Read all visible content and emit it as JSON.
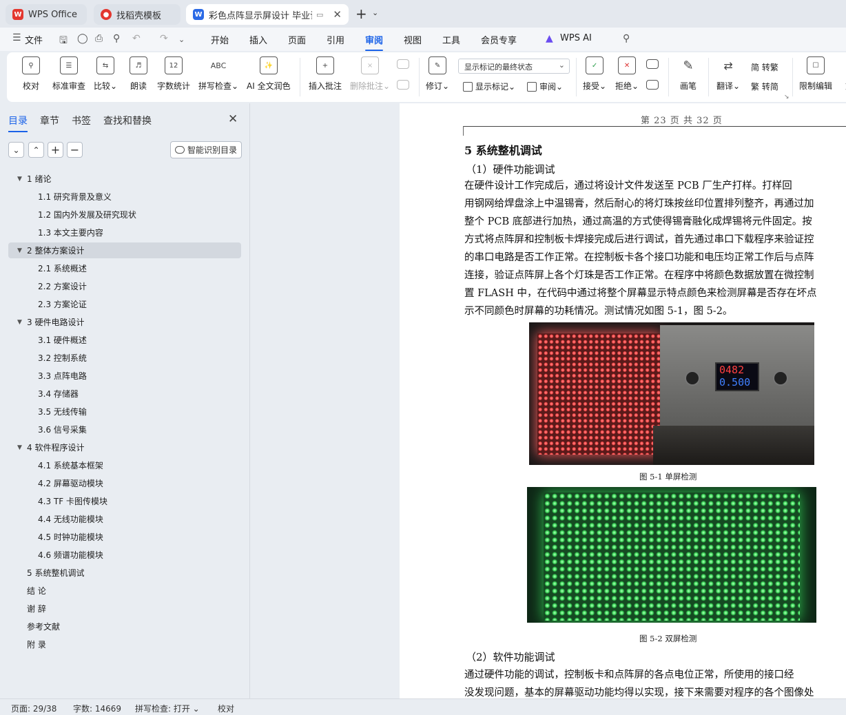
{
  "tabs": [
    {
      "label": "WPS Office",
      "icon": "wps-logo-icon"
    },
    {
      "label": "找稻壳模板",
      "icon": "docer-logo-icon"
    },
    {
      "label": "彩色点阵显示屏设计 毕业论文",
      "icon": "word-doc-icon"
    }
  ],
  "menu": {
    "file": "文件",
    "items": [
      "开始",
      "插入",
      "页面",
      "引用",
      "审阅",
      "视图",
      "工具",
      "会员专享"
    ],
    "active": "审阅",
    "ai": "WPS AI"
  },
  "ribbon": {
    "proofread": "校对",
    "std_review": "标准审查",
    "compare": "比较",
    "read_aloud": "朗读",
    "word_count": "字数统计",
    "spell_check": "拼写检查",
    "ai_polish": "AI 全文润色",
    "insert_comment": "插入批注",
    "delete_comment": "删除批注",
    "track": "修订",
    "markup_mode": "显示标记的最终状态",
    "show_markup": "显示标记",
    "review_pane": "审阅",
    "accept": "接受",
    "reject": "拒绝",
    "pen": "画笔",
    "translate": "翻译",
    "to_traditional": "简 转繁",
    "to_simplified": "繁 转简",
    "restrict": "限制编辑",
    "doc_partial": "文"
  },
  "nav": {
    "tabs": [
      "目录",
      "章节",
      "书签",
      "查找和替换"
    ],
    "smart_toc": "智能识别目录",
    "toc": [
      {
        "label": "1   绪论",
        "level": 1,
        "expand": true
      },
      {
        "label": "1.1  研究背景及意义",
        "level": 2
      },
      {
        "label": "1.2  国内外发展及研究现状",
        "level": 2
      },
      {
        "label": "1.3  本文主要内容",
        "level": 2
      },
      {
        "label": "2   整体方案设计",
        "level": 1,
        "expand": true,
        "selected": true
      },
      {
        "label": "2.1  系统概述",
        "level": 2
      },
      {
        "label": "2.2  方案设计",
        "level": 2
      },
      {
        "label": "2.3  方案论证",
        "level": 2
      },
      {
        "label": "3   硬件电路设计",
        "level": 1,
        "expand": true
      },
      {
        "label": "3.1  硬件概述",
        "level": 2
      },
      {
        "label": "3.2  控制系统",
        "level": 2
      },
      {
        "label": "3.3  点阵电路",
        "level": 2
      },
      {
        "label": "3.4  存储器",
        "level": 2
      },
      {
        "label": "3.5  无线传输",
        "level": 2
      },
      {
        "label": "3.6  信号采集",
        "level": 2
      },
      {
        "label": "4   软件程序设计",
        "level": 1,
        "expand": true
      },
      {
        "label": "4.1  系统基本框架",
        "level": 2
      },
      {
        "label": "4.2  屏幕驱动模块",
        "level": 2
      },
      {
        "label": "4.3 TF 卡图传模块",
        "level": 2
      },
      {
        "label": "4.4  无线功能模块",
        "level": 2
      },
      {
        "label": "4.5  时钟功能模块",
        "level": 2
      },
      {
        "label": "4.6  频谱功能模块",
        "level": 2
      },
      {
        "label": "5   系统整机调试",
        "level": 1
      },
      {
        "label": "结   论",
        "level": 0
      },
      {
        "label": "谢   辞",
        "level": 0
      },
      {
        "label": "参考文献",
        "level": 0
      },
      {
        "label": "附   录",
        "level": 0
      }
    ]
  },
  "doc": {
    "page_header": "第 23 页   共 32 页",
    "heading": "5    系统整机调试",
    "sub1": "（1）硬件功能调试",
    "para1": [
      "        在硬件设计工作完成后，通过将设计文件发送至 PCB 厂生产打样。打样回",
      "用钢网给焊盘涂上中温锡膏，然后耐心的将灯珠按丝印位置排列整齐，再通过加",
      "整个 PCB 底部进行加热，通过高温的方式使得锡膏融化成焊锡将元件固定。按",
      "方式将点阵屏和控制板卡焊接完成后进行调试，首先通过串口下载程序来验证控",
      "的串口电路是否工作正常。在控制板卡各个接口功能和电压均正常工作后与点阵",
      "连接，验证点阵屏上各个灯珠是否工作正常。在程序中将颜色数据放置在微控制",
      "置 FLASH 中，在代码中通过将整个屏幕显示特点颜色来检测屏幕是否存在坏点",
      "示不同颜色时屏幕的功耗情况。测试情况如图 5-1，图 5-2。"
    ],
    "meter_top": "0482",
    "meter_bottom": "0.500",
    "fig1": "图 5-1  单屏检测",
    "fig2": "图 5-2  双屏检测",
    "sub2": "（2）软件功能调试",
    "para2": [
      "        通过硬件功能的调试，控制板卡和点阵屏的各点电位正常，所使用的接口经",
      "没发现问题，基本的屏幕驱动功能均得以实现，接下来需要对程序的各个图像处"
    ]
  },
  "status": {
    "page": "页面: 29/38",
    "words": "字数: 14669",
    "spell": "拼写检查: 打开",
    "proof": "校对"
  },
  "colors": {
    "accent": "#1a62e8"
  }
}
